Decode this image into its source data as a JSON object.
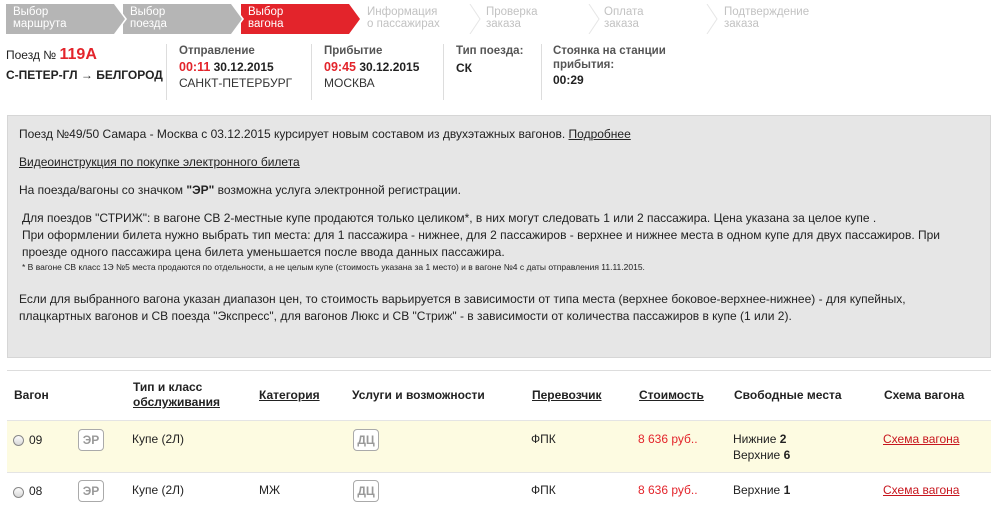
{
  "steps": [
    {
      "line1": "Выбор",
      "line2": "маршрута",
      "state": "done"
    },
    {
      "line1": "Выбор",
      "line2": "поезда",
      "state": "done"
    },
    {
      "line1": "Выбор",
      "line2": "вагона",
      "state": "active"
    },
    {
      "line1": "Информация",
      "line2": "о пассажирах",
      "state": "future"
    },
    {
      "line1": "Проверка",
      "line2": "заказа",
      "state": "future"
    },
    {
      "line1": "Оплата",
      "line2": "заказа",
      "state": "future"
    },
    {
      "line1": "Подтверждение",
      "line2": "заказа",
      "state": "future"
    }
  ],
  "train": {
    "prefix": "Поезд №",
    "number": "119А",
    "route": "С-ПЕТЕР-ГЛ → БЕЛГОРОД"
  },
  "departure": {
    "label": "Отправление",
    "time": "00:11",
    "date": "30.12.2015",
    "city": "САНКТ-ПЕТЕРБУРГ"
  },
  "arrival": {
    "label": "Прибытие",
    "time": "09:45",
    "date": "30.12.2015",
    "city": "МОСКВА"
  },
  "train_type": {
    "label": "Тип поезда:",
    "value": "СК"
  },
  "stop": {
    "label_line1": "Стоянка на станции",
    "label_line2": "прибытия:",
    "value": "00:29"
  },
  "notice": {
    "p1_text": "Поезд №49/50 Самара - Москва с 03.12.2015 курсирует новым составом из двухэтажных вагонов. ",
    "p1_link": "Подробнее",
    "p2_link": "Видеоинструкция по покупке электронного билета",
    "p3_before": "На поезда/вагоны со значком ",
    "p3_bold": "\"ЭР\"",
    "p3_after": " возможна услуга электронной регистрации.",
    "p4_l1": "Для поездов \"СТРИЖ\": в вагоне СВ 2-местные купе продаются только целиком*, в них могут следовать 1 или 2 пассажира. Цена указана за целое купе .",
    "p4_l2": "При оформлении билета нужно выбрать тип места: для 1 пассажира - нижнее, для 2 пассажиров - верхнее и нижнее места в одном купе для двух пассажиров. При",
    "p4_l3": "проезде одного пассажира цена билета уменьшается после ввода данных пассажира.",
    "p4_small": "* В вагоне СВ класс 1Э №5 места продаются по отдельности, а не целым купе (стоимость указана за 1 место) и в вагоне №4 с даты отправления 11.11.2015.",
    "p5_l1": "Если для выбранного вагона указан диапазон цен, то стоимость варьируется в зависимости от типа места (верхнее боковое-верхнее-нижнее) - для купейных,",
    "p5_l2": "плацкартных вагонов и СВ поезда \"Экспресс\", для вагонов Люкс и СВ \"Стриж\" - в зависимости от количества пассажиров в купе (1 или 2)."
  },
  "table": {
    "headers": {
      "wagon": "Вагон",
      "class_l1": "Тип и класс",
      "class_l2": "обслуживания",
      "category": "Категория",
      "services": "Услуги и возможности",
      "carrier": "Перевозчик",
      "cost": "Стоимость",
      "seats": "Свободные места",
      "scheme": "Схема вагона"
    },
    "rows": [
      {
        "wagon": "09",
        "er": "ЭР",
        "class": "Купе (2Л)",
        "category": "",
        "service": "ДЦ",
        "carrier": "ФПК",
        "price": "8 636 руб..",
        "seats1_label": "Нижние ",
        "seats1_val": "2",
        "seats2_label": "Верхние ",
        "seats2_val": "6",
        "scheme": "Схема вагона"
      },
      {
        "wagon": "08",
        "er": "ЭР",
        "class": "Купе (2Л)",
        "category": "МЖ",
        "service": "ДЦ",
        "carrier": "ФПК",
        "price": "8 636 руб..",
        "seats1_label": "Верхние ",
        "seats1_val": "1",
        "seats2_label": "",
        "seats2_val": "",
        "scheme": "Схема вагона"
      }
    ]
  },
  "colors": {
    "accent": "#e3242b",
    "step_done": "#b5b5b5",
    "notice_bg": "#e6e6e6",
    "selected_row": "#fdfbe1"
  }
}
